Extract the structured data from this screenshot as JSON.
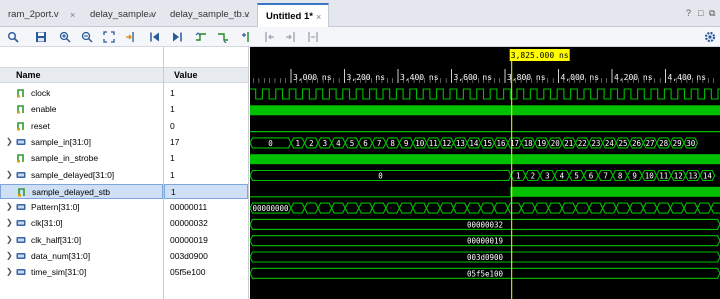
{
  "tabs": [
    {
      "label": "ram_2port.v",
      "active": false
    },
    {
      "label": "delay_sample.v",
      "active": false
    },
    {
      "label": "delay_sample_tb.v",
      "active": false
    },
    {
      "label": "Untitled 1*",
      "active": true
    }
  ],
  "close_glyph": "×",
  "window_buttons": {
    "help": "?",
    "restore": "□",
    "maximize": "⧉"
  },
  "columns": {
    "name": "Name",
    "value": "Value"
  },
  "cursor_time": "3,825.000 ns",
  "time_ticks": [
    "3,000 ns",
    "3,200 ns",
    "3,400 ns",
    "3,600 ns",
    "3,800 ns",
    "4,000 ns",
    "4,200 ns",
    "4,400 ns"
  ],
  "signals": [
    {
      "name": "clock",
      "value": "1",
      "kind": "bit",
      "expandable": false
    },
    {
      "name": "enable",
      "value": "1",
      "kind": "bit",
      "expandable": false
    },
    {
      "name": "reset",
      "value": "0",
      "kind": "bit",
      "expandable": false
    },
    {
      "name": "sample_in[31:0]",
      "value": "17",
      "kind": "bus",
      "expandable": true
    },
    {
      "name": "sample_in_strobe",
      "value": "1",
      "kind": "bit",
      "expandable": false
    },
    {
      "name": "sample_delayed[31:0]",
      "value": "1",
      "kind": "bus",
      "expandable": true
    },
    {
      "name": "sample_delayed_stb",
      "value": "1",
      "kind": "bit",
      "expandable": false,
      "selected": true
    },
    {
      "name": "Pattern[31:0]",
      "value": "00000011",
      "kind": "bus",
      "expandable": true
    },
    {
      "name": "clk[31:0]",
      "value": "00000032",
      "kind": "bus",
      "expandable": true
    },
    {
      "name": "clk_half[31:0]",
      "value": "00000019",
      "kind": "bus",
      "expandable": true
    },
    {
      "name": "data_num[31:0]",
      "value": "003d0900",
      "kind": "bus",
      "expandable": true
    },
    {
      "name": "time_sim[31:0]",
      "value": "05f5e100",
      "kind": "bus",
      "expandable": true
    }
  ],
  "wave_labels": {
    "sample_in_start": "0",
    "sample_in_values": [
      "1",
      "2",
      "3",
      "4",
      "5",
      "6",
      "7",
      "8",
      "9",
      "10",
      "11",
      "12",
      "13",
      "14",
      "15",
      "16",
      "17",
      "18",
      "19",
      "20",
      "21",
      "22",
      "23",
      "24",
      "25",
      "26",
      "27",
      "28",
      "29",
      "30"
    ],
    "sample_delayed_start": "0",
    "sample_delayed_values": [
      "1",
      "2",
      "3",
      "4",
      "5",
      "6",
      "7",
      "8",
      "9",
      "10",
      "11",
      "12",
      "13",
      "14"
    ],
    "pattern_start": "00000000",
    "clk": "00000032",
    "clk_half": "00000019",
    "data_num": "003d0900",
    "time_sim": "05f5e100"
  },
  "colors": {
    "wave_green": "#00c000",
    "cursor": "#ffff00",
    "bus_text": "#ffffff",
    "accent": "#3b76c4"
  },
  "toolbar_icons": [
    "search-icon",
    "save-icon",
    "zoom-in-icon",
    "zoom-out-icon",
    "zoom-fit-icon",
    "go-to-cursor-icon",
    "go-to-start-icon",
    "go-to-end-icon",
    "previous-transition-icon",
    "next-transition-icon",
    "add-marker-icon",
    "previous-marker-icon",
    "next-marker-icon",
    "swap-cursors-icon"
  ],
  "settings_icon": "gear-icon"
}
